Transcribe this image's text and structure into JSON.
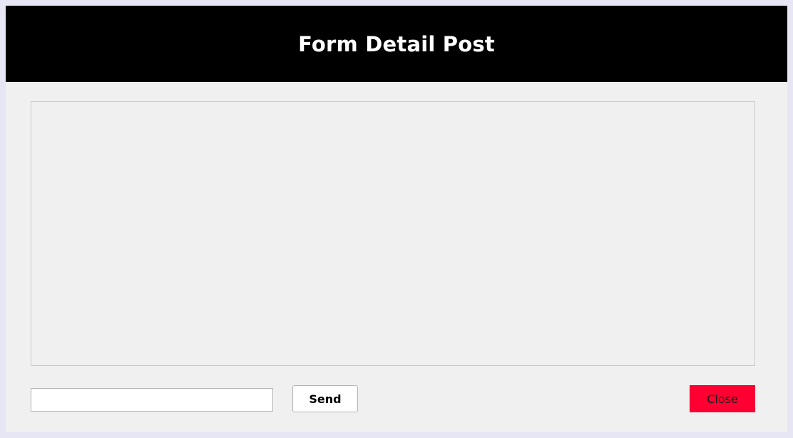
{
  "window": {
    "title": "Form Detail Post"
  },
  "content": {
    "text": ""
  },
  "footer": {
    "input_value": "",
    "input_placeholder": "",
    "send_label": "Send",
    "close_label": "Close"
  },
  "colors": {
    "header_bg": "#000000",
    "header_text": "#ffffff",
    "close_bg": "#ff0033",
    "panel_bg": "#f0f0f0"
  }
}
